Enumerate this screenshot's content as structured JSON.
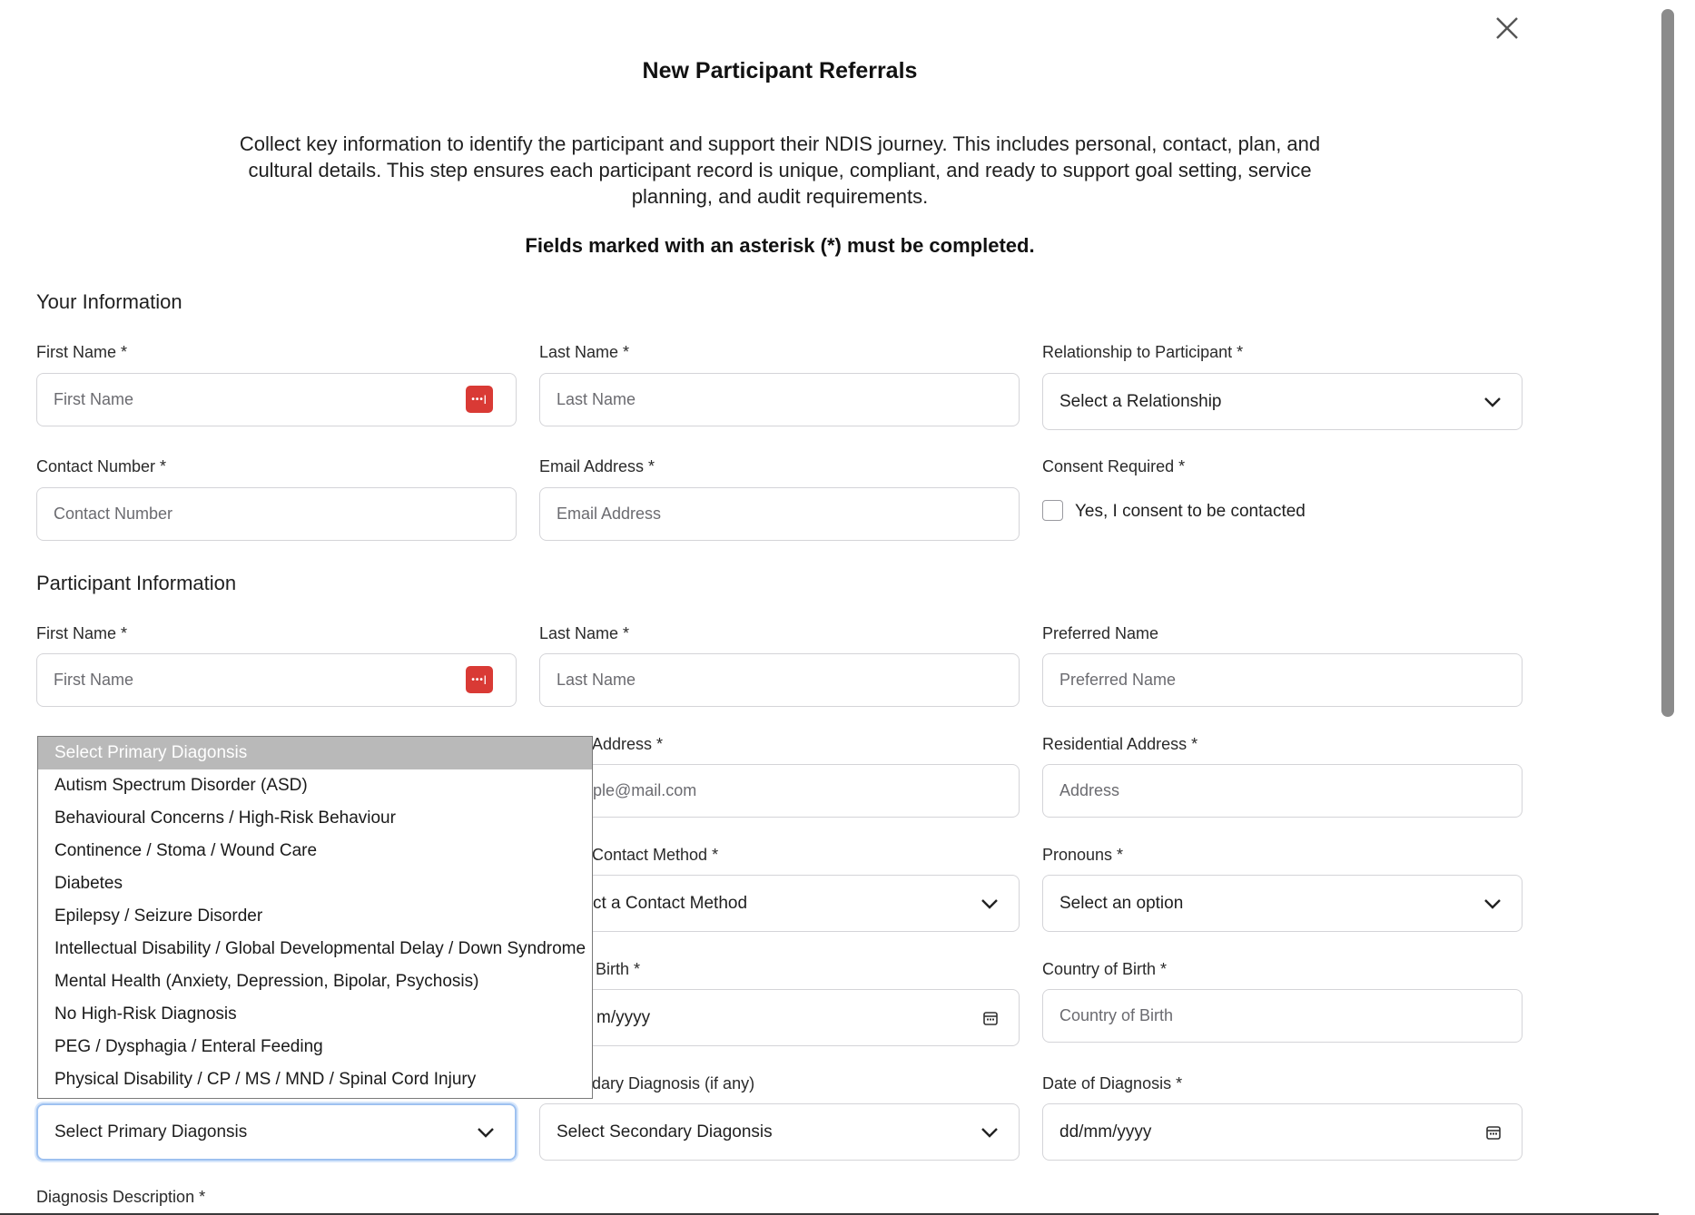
{
  "modal": {
    "title": "New Participant Referrals",
    "intro": "Collect key information to identify the participant and support their NDIS journey. This includes personal, contact, plan, and cultural details. This step ensures each participant record is unique, compliant, and ready to support goal setting, service planning, and audit requirements.",
    "required_note": "Fields marked with an asterisk (*) must be completed."
  },
  "your_info": {
    "section_title": "Your Information",
    "first_name": {
      "label": "First Name *",
      "placeholder": "First Name",
      "value": ""
    },
    "last_name": {
      "label": "Last Name *",
      "placeholder": "Last Name",
      "value": ""
    },
    "relationship": {
      "label": "Relationship to Participant *",
      "value": "Select a Relationship"
    },
    "contact_number": {
      "label": "Contact Number *",
      "placeholder": "Contact Number",
      "value": ""
    },
    "email": {
      "label": "Email Address *",
      "placeholder": "Email Address",
      "value": ""
    },
    "consent": {
      "label": "Consent Required *",
      "checkbox_label": "Yes, I consent to be contacted",
      "checked": false
    }
  },
  "participant_info": {
    "section_title": "Participant Information",
    "first_name": {
      "label": "First Name *",
      "placeholder": "First Name",
      "value": ""
    },
    "last_name": {
      "label": "Last Name *",
      "placeholder": "Last Name",
      "value": ""
    },
    "preferred_name": {
      "label": "Preferred Name",
      "placeholder": "Preferred Name",
      "value": ""
    },
    "email": {
      "label": "Address *",
      "placeholder": "ple@mail.com",
      "value": ""
    },
    "residential_address": {
      "label": "Residential Address *",
      "placeholder": "Address",
      "value": ""
    },
    "contact_method": {
      "label": "Contact Method *",
      "value": "ct a Contact Method"
    },
    "pronouns": {
      "label": "Pronouns *",
      "value": "Select an option"
    },
    "dob": {
      "label": "Birth *",
      "value": "m/yyyy"
    },
    "country_of_birth": {
      "label": "Country of Birth *",
      "placeholder": "Country of Birth",
      "value": ""
    },
    "primary_diagnosis": {
      "value": "Select Primary Diagonsis"
    },
    "secondary_diagnosis": {
      "label": "dary Diagnosis (if any)",
      "value": "Select Secondary Diagonsis"
    },
    "date_of_diagnosis": {
      "label": "Date of Diagnosis *",
      "value": "dd/mm/yyyy"
    },
    "diagnosis_description": {
      "label": "Diagnosis Description *"
    }
  },
  "primary_diagnosis_options": [
    "Select Primary Diagonsis",
    "Autism Spectrum Disorder (ASD)",
    "Behavioural Concerns / High-Risk Behaviour",
    "Continence / Stoma / Wound Care",
    "Diabetes",
    "Epilepsy / Seizure Disorder",
    "Intellectual Disability / Global Developmental Delay / Down Syndrome",
    "Mental Health (Anxiety, Depression, Bipolar, Psychosis)",
    "No High-Risk Diagnosis",
    "PEG / Dysphagia / Enteral Feeding",
    "Physical Disability / CP / MS / MND / Spinal Cord Injury"
  ],
  "password_manager_icon_text": "•••|",
  "icons": {
    "close": "close-icon",
    "chevron": "chevron-down-icon",
    "calendar": "calendar-icon",
    "password_manager": "password-manager-icon"
  },
  "colors": {
    "password_manager": "#d93a35",
    "focus_ring": "#9ec1f0",
    "selected_option_bg": "#b9b9b9"
  }
}
